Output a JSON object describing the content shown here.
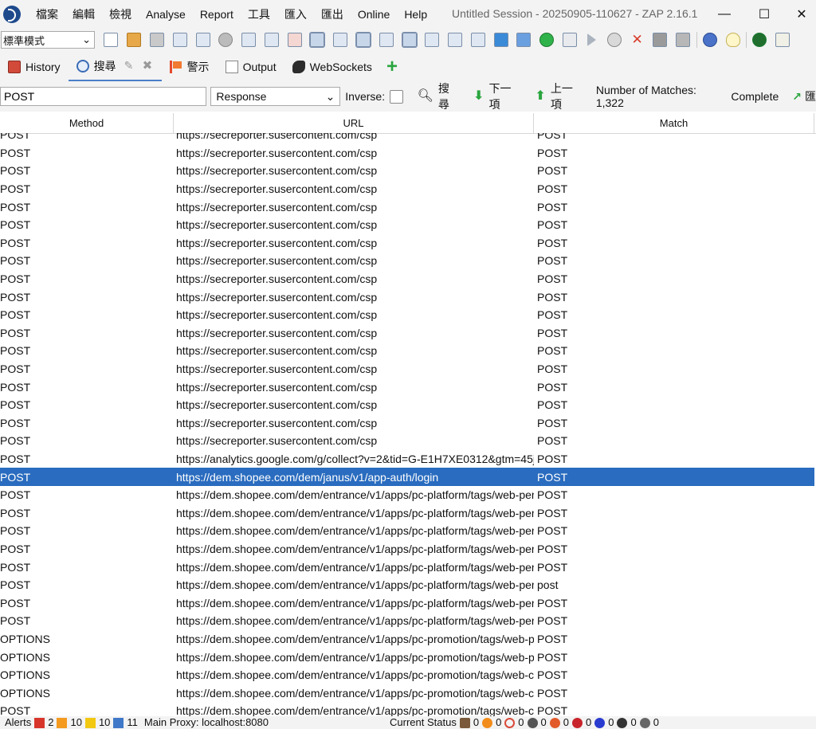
{
  "window": {
    "title": "Untitled Session - 20250905-110627 - ZAP 2.16.1",
    "minimize": "—",
    "maximize": "☐",
    "close": "✕"
  },
  "menu": [
    "檔案",
    "編輯",
    "檢視",
    "Analyse",
    "Report",
    "工具",
    "匯入",
    "匯出",
    "Online",
    "Help"
  ],
  "toolbar": {
    "mode": "標準模式"
  },
  "tabs": {
    "history": "History",
    "search": "搜尋",
    "alerts": "警示",
    "output": "Output",
    "websockets": "WebSockets"
  },
  "search": {
    "query": "POST",
    "type": "Response",
    "inverse_label": "Inverse:",
    "search_button": "搜尋",
    "next_button": "下一項",
    "prev_button": "上一項",
    "matches": "Number of Matches: 1,322",
    "status": "Complete",
    "export_button": "匯"
  },
  "table": {
    "columns": [
      "Method",
      "URL",
      "Match"
    ],
    "rows": [
      [
        "POST",
        "https://secreporter.susercontent.com/csp",
        "POST"
      ],
      [
        "POST",
        "https://secreporter.susercontent.com/csp",
        "POST"
      ],
      [
        "POST",
        "https://secreporter.susercontent.com/csp",
        "POST"
      ],
      [
        "POST",
        "https://secreporter.susercontent.com/csp",
        "POST"
      ],
      [
        "POST",
        "https://secreporter.susercontent.com/csp",
        "POST"
      ],
      [
        "POST",
        "https://secreporter.susercontent.com/csp",
        "POST"
      ],
      [
        "POST",
        "https://secreporter.susercontent.com/csp",
        "POST"
      ],
      [
        "POST",
        "https://secreporter.susercontent.com/csp",
        "POST"
      ],
      [
        "POST",
        "https://secreporter.susercontent.com/csp",
        "POST"
      ],
      [
        "POST",
        "https://secreporter.susercontent.com/csp",
        "POST"
      ],
      [
        "POST",
        "https://secreporter.susercontent.com/csp",
        "POST"
      ],
      [
        "POST",
        "https://secreporter.susercontent.com/csp",
        "POST"
      ],
      [
        "POST",
        "https://secreporter.susercontent.com/csp",
        "POST"
      ],
      [
        "POST",
        "https://secreporter.susercontent.com/csp",
        "POST"
      ],
      [
        "POST",
        "https://secreporter.susercontent.com/csp",
        "POST"
      ],
      [
        "POST",
        "https://secreporter.susercontent.com/csp",
        "POST"
      ],
      [
        "POST",
        "https://secreporter.susercontent.com/csp",
        "POST"
      ],
      [
        "POST",
        "https://secreporter.susercontent.com/csp",
        "POST"
      ],
      [
        "POST",
        "https://analytics.google.com/g/collect?v=2&tid=G-E1H7XE0312&gtm=45je59",
        "POST"
      ],
      [
        "POST",
        "https://dem.shopee.com/dem/janus/v1/app-auth/login",
        "POST"
      ],
      [
        "POST",
        "https://dem.shopee.com/dem/entrance/v1/apps/pc-platform/tags/web-perfor",
        "POST"
      ],
      [
        "POST",
        "https://dem.shopee.com/dem/entrance/v1/apps/pc-platform/tags/web-perfor",
        "POST"
      ],
      [
        "POST",
        "https://dem.shopee.com/dem/entrance/v1/apps/pc-platform/tags/web-perfor",
        "POST"
      ],
      [
        "POST",
        "https://dem.shopee.com/dem/entrance/v1/apps/pc-platform/tags/web-perfor",
        "POST"
      ],
      [
        "POST",
        "https://dem.shopee.com/dem/entrance/v1/apps/pc-platform/tags/web-perfor",
        "POST"
      ],
      [
        "POST",
        "https://dem.shopee.com/dem/entrance/v1/apps/pc-platform/tags/web-perfor",
        "post"
      ],
      [
        "POST",
        "https://dem.shopee.com/dem/entrance/v1/apps/pc-platform/tags/web-perfor",
        "POST"
      ],
      [
        "POST",
        "https://dem.shopee.com/dem/entrance/v1/apps/pc-platform/tags/web-perfor",
        "POST"
      ],
      [
        "OPTIONS",
        "https://dem.shopee.com/dem/entrance/v1/apps/pc-promotion/tags/web-perfo",
        "POST"
      ],
      [
        "OPTIONS",
        "https://dem.shopee.com/dem/entrance/v1/apps/pc-promotion/tags/web-perfo",
        "POST"
      ],
      [
        "OPTIONS",
        "https://dem.shopee.com/dem/entrance/v1/apps/pc-promotion/tags/web-custo",
        "POST"
      ],
      [
        "OPTIONS",
        "https://dem.shopee.com/dem/entrance/v1/apps/pc-promotion/tags/web-custo",
        "POST"
      ],
      [
        "POST",
        "https://dem.shopee.com/dem/entrance/v1/apps/pc-promotion/tags/web-custo",
        "POST"
      ],
      [
        "POST",
        "https://dem.shopee.com/dem/entrance/v1/apps/pc-promotion/tags/web-perfo",
        "POST"
      ]
    ],
    "selected_row": 19
  },
  "status": {
    "alerts_label": "Alerts",
    "alert_high": "2",
    "alert_medium": "10",
    "alert_low": "10",
    "alert_info": "11",
    "proxy": "Main Proxy: localhost:8080",
    "current_status": "Current Status",
    "counts": [
      "0",
      "0",
      "0",
      "0",
      "0",
      "0",
      "0",
      "0",
      "0"
    ]
  },
  "colors": {
    "selection": "#2a6cbf",
    "chrome": "#f3f3f3",
    "accent_tab": "#4a7fc8"
  }
}
